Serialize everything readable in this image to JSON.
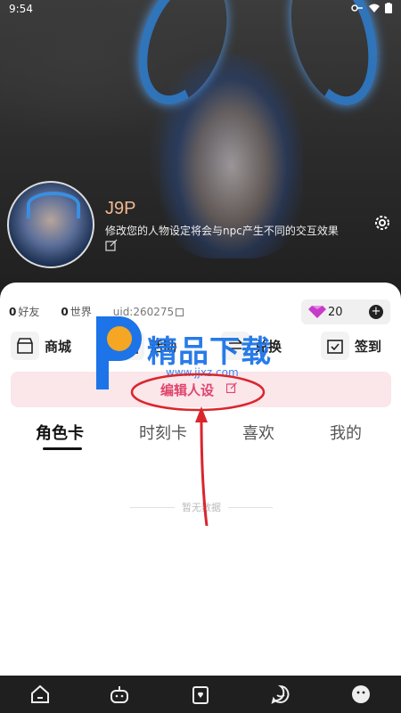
{
  "status_bar": {
    "time": "9:54"
  },
  "profile": {
    "name": "J9P",
    "description": "修改您的人物设定将会与npc产生不同的交互效果"
  },
  "stats": {
    "friends_count": "0",
    "friends_label": "好友",
    "world_count": "0",
    "world_label": "世界",
    "uid": "uid:260275"
  },
  "gems": {
    "count": "20",
    "plus": "+"
  },
  "features": [
    {
      "label": "商城",
      "icon": "store-icon"
    },
    {
      "label": "活动",
      "icon": "gift-icon"
    },
    {
      "label": "兑换",
      "icon": "exchange-icon"
    },
    {
      "label": "签到",
      "icon": "calendar-check-icon"
    }
  ],
  "edit_banner": {
    "label": "编辑人设"
  },
  "tabs": [
    "角色卡",
    "时刻卡",
    "喜欢",
    "我的"
  ],
  "empty_text": "暂无数据",
  "watermark": {
    "text": "精品下载",
    "url": "www.jjxz.com"
  },
  "colors": {
    "accent_pink": "#e0456e",
    "banner_bg": "#fbe6ea",
    "gem": "#c63cc9",
    "watermark_blue": "#1d74e8",
    "annotation_red": "#d9262c"
  },
  "bottom_nav": [
    {
      "icon": "home-icon"
    },
    {
      "icon": "robot-icon"
    },
    {
      "icon": "card-icon"
    },
    {
      "icon": "chat-bubble-icon"
    },
    {
      "icon": "smiley-icon"
    }
  ]
}
